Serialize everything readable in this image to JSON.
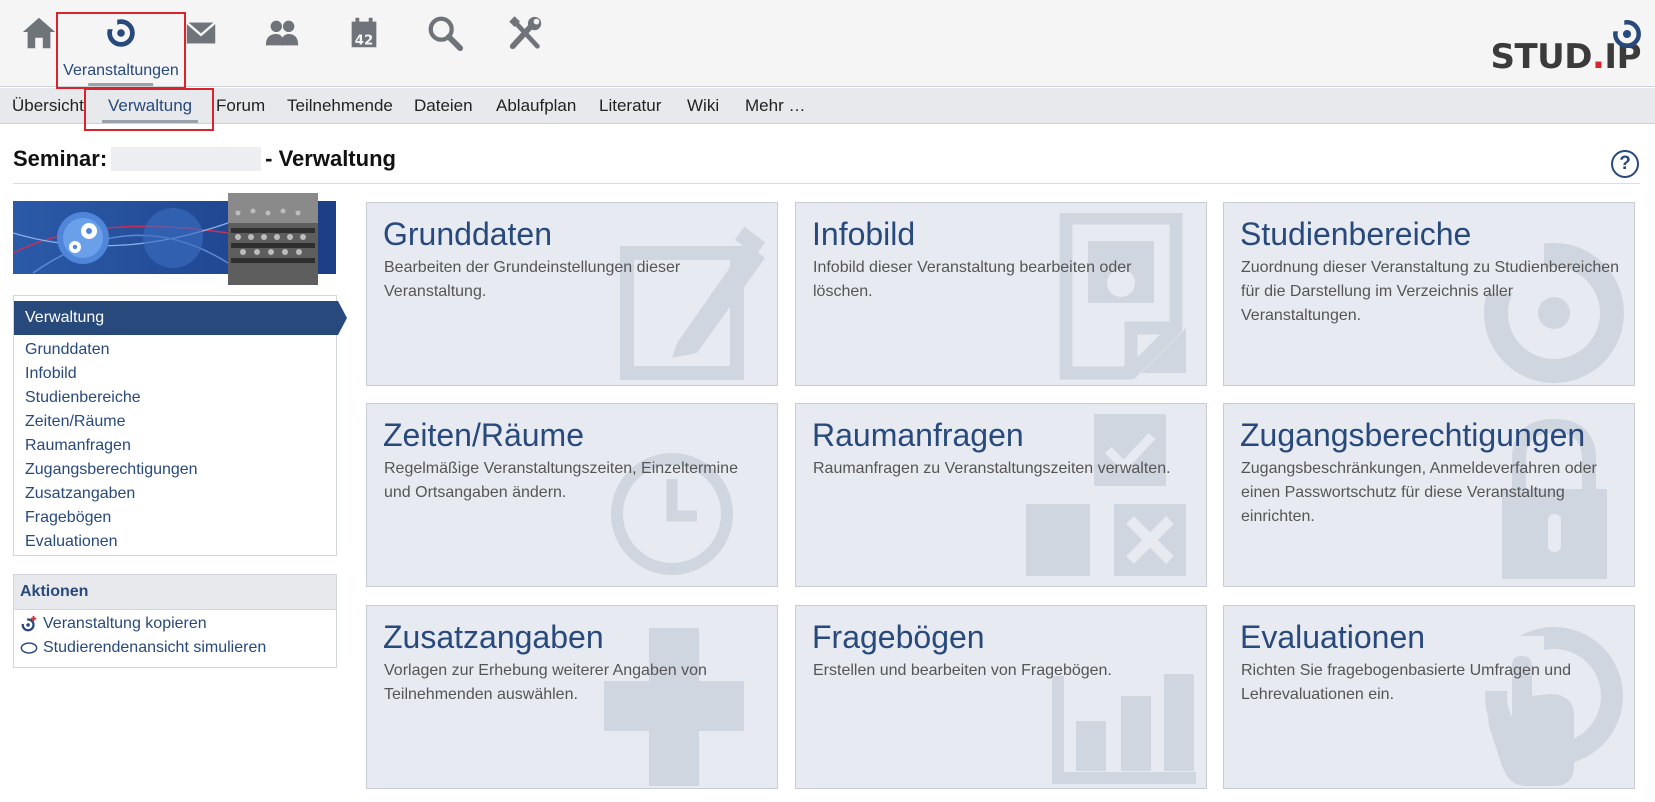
{
  "topnav": {
    "items": [
      {
        "name": "home-icon"
      },
      {
        "name": "courses-icon",
        "label": "Veranstaltungen"
      },
      {
        "name": "mail-icon"
      },
      {
        "name": "community-icon"
      },
      {
        "name": "calendar-icon",
        "calendar_day": "42"
      },
      {
        "name": "search-icon"
      },
      {
        "name": "tools-icon"
      }
    ]
  },
  "logo": {
    "text_a": "STUD",
    "text_b": ".",
    "text_c": "IP"
  },
  "subnav": {
    "items": [
      "Übersicht",
      "Verwaltung",
      "Forum",
      "Teilnehmende",
      "Dateien",
      "Ablaufplan",
      "Literatur",
      "Wiki",
      "Mehr …"
    ],
    "active": "Verwaltung"
  },
  "page": {
    "title_prefix": "Seminar:",
    "title_suffix": "- Verwaltung",
    "help": "?"
  },
  "sidebar": {
    "heading": "Verwaltung",
    "items": [
      "Grunddaten",
      "Infobild",
      "Studienbereiche",
      "Zeiten/Räume",
      "Raumanfragen",
      "Zugangsberechtigungen",
      "Zusatzangaben",
      "Fragebögen",
      "Evaluationen"
    ]
  },
  "actions": {
    "heading": "Aktionen",
    "items": [
      "Veranstaltung kopieren",
      "Studierendenansicht simulieren"
    ]
  },
  "tiles": [
    {
      "title": "Grunddaten",
      "desc": "Bearbeiten der Grundeinstellungen dieser Veranstaltung.",
      "icon": "edit-icon"
    },
    {
      "title": "Infobild",
      "desc": "Infobild dieser Veranstaltung bearbeiten oder löschen.",
      "icon": "image-file-icon"
    },
    {
      "title": "Studienbereiche",
      "desc": "Zuordnung dieser Veranstaltung zu Studienbereichen für die Darstellung im Verzeichnis aller Veranstaltungen.",
      "icon": "course-seminar-icon"
    },
    {
      "title": "Zeiten/Räume",
      "desc": "Regelmäßige Veranstaltungszeiten, Einzeltermine und Ortsangaben ändern.",
      "icon": "clock-icon"
    },
    {
      "title": "Raumanfragen",
      "desc": "Raumanfragen zu Veranstaltungszeiten verwalten.",
      "icon": "room-request-icon"
    },
    {
      "title": "Zugangsberechtigungen",
      "desc": "Zugangsbeschränkungen, Anmeldeverfahren oder einen Passwortschutz für diese Veranstaltung einrichten.",
      "icon": "lock-icon"
    },
    {
      "title": "Zusatzangaben",
      "desc": "Vorlagen zur Erhebung weiterer Angaben von Teilnehmenden auswählen.",
      "icon": "plus-icon"
    },
    {
      "title": "Fragebögen",
      "desc": "Erstellen und bearbeiten von Fragebögen.",
      "icon": "bar-chart-icon"
    },
    {
      "title": "Evaluationen",
      "desc": "Richten Sie fragebogenbasierte Umfragen und Lehrevaluationen ein.",
      "icon": "evaluation-hand-icon"
    }
  ],
  "colors": {
    "brand_blue": "#28497c",
    "highlight_red": "#d9242e",
    "tile_bg": "#e7eaf0",
    "tile_icon": "#d0d6e0"
  }
}
